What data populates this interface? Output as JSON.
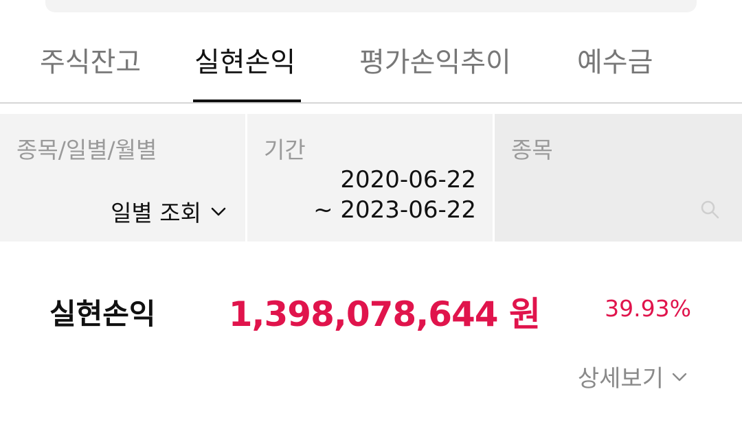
{
  "tabs": [
    {
      "label": "주식잔고",
      "active": false
    },
    {
      "label": "실현손익",
      "active": true
    },
    {
      "label": "평가손익추이",
      "active": false
    },
    {
      "label": "예수금",
      "active": false
    }
  ],
  "filters": {
    "view_type": {
      "label": "종목/일별/월별",
      "value": "일별 조회",
      "icon": "chevron-down-icon"
    },
    "period": {
      "label": "기간",
      "start": "2020-06-22",
      "end": "~ 2023-06-22"
    },
    "stock": {
      "label": "종목",
      "icon": "search-icon"
    }
  },
  "summary": {
    "label": "실현손익",
    "amount": "1,398,078,644 원",
    "rate": "39.93%",
    "detail_label": "상세보기",
    "detail_icon": "chevron-down-icon"
  },
  "colors": {
    "accent_red": "#e0144c",
    "active_text": "#111111",
    "inactive_text": "#777777",
    "filter_bg": "#f3f3f3"
  }
}
